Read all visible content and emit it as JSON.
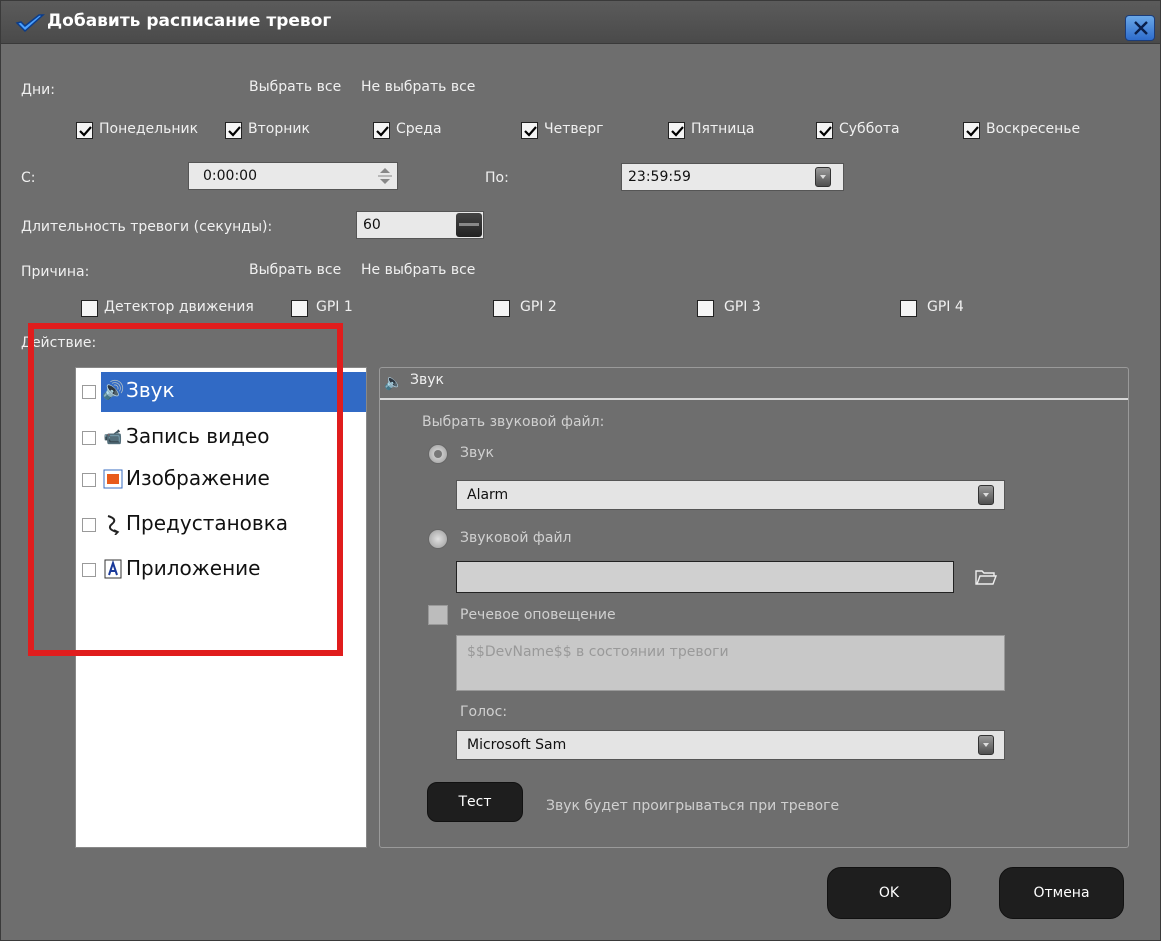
{
  "window": {
    "title": "Добавить расписание тревог",
    "icon": "check-logo-icon",
    "close_icon": "close-icon"
  },
  "days": {
    "label": "Дни:",
    "select_all": "Выбрать все",
    "deselect_all": "Не выбрать все",
    "items": [
      {
        "label": "Понедельник",
        "checked": true
      },
      {
        "label": "Вторник",
        "checked": true
      },
      {
        "label": "Среда",
        "checked": true
      },
      {
        "label": "Четверг",
        "checked": true
      },
      {
        "label": "Пятница",
        "checked": true
      },
      {
        "label": "Суббота",
        "checked": true
      },
      {
        "label": "Воскресенье",
        "checked": true
      }
    ]
  },
  "time": {
    "from_label": "С:",
    "from_value": "0:00:00",
    "to_label": "По:",
    "to_value": "23:59:59"
  },
  "duration": {
    "label": "Длительность тревоги (секунды):",
    "value": "60"
  },
  "reason": {
    "label": "Причина:",
    "select_all": "Выбрать все",
    "deselect_all": "Не выбрать все",
    "items": [
      {
        "label": "Детектор движения",
        "checked": false
      },
      {
        "label": "GPI 1",
        "checked": false
      },
      {
        "label": "GPI 2",
        "checked": false
      },
      {
        "label": "GPI 3",
        "checked": false
      },
      {
        "label": "GPI 4",
        "checked": false
      }
    ]
  },
  "action": {
    "label": "Действие:",
    "items": [
      {
        "label": "Звук",
        "icon": "speaker-icon",
        "selected": true
      },
      {
        "label": "Запись видео",
        "icon": "video-camera-icon",
        "selected": false
      },
      {
        "label": "Изображение",
        "icon": "image-icon",
        "selected": false
      },
      {
        "label": "Предустановка",
        "icon": "preset-arrow-icon",
        "selected": false
      },
      {
        "label": "Приложение",
        "icon": "application-icon",
        "selected": false
      }
    ]
  },
  "sound_panel": {
    "header": "Звук",
    "choose_label": "Выбрать звуковой файл:",
    "radio_sound": "Звук",
    "sound_value": "Alarm",
    "radio_file": "Звуковой файл",
    "file_value": "",
    "speech_label": "Речевое оповещение",
    "speech_text": "$$DevName$$ в состоянии тревоги",
    "voice_label": "Голос:",
    "voice_value": "Microsoft Sam",
    "test_button": "Тест",
    "test_note": "Звук будет проигрываться при тревоге"
  },
  "footer": {
    "ok": "OK",
    "cancel": "Отмена"
  },
  "colors": {
    "window_bg": "#6e6e6e",
    "selection": "#316ac5",
    "highlight_frame": "#e01d1d"
  }
}
